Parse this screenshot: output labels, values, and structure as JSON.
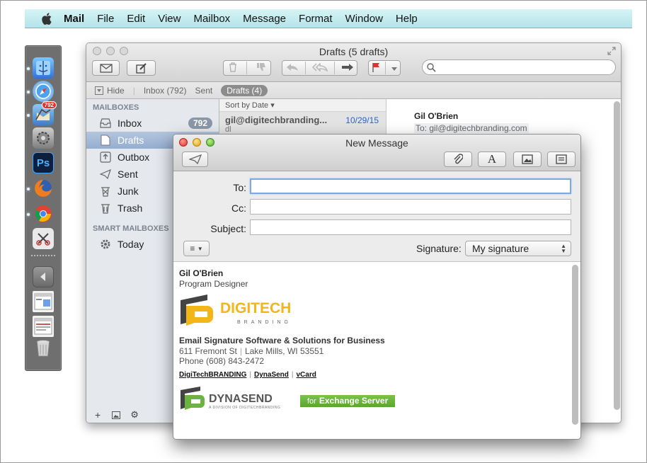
{
  "menubar": {
    "app": "Mail",
    "items": [
      "File",
      "Edit",
      "View",
      "Mailbox",
      "Message",
      "Format",
      "Window",
      "Help"
    ]
  },
  "dock": {
    "items": [
      {
        "icon": "finder-icon"
      },
      {
        "icon": "safari-icon"
      },
      {
        "icon": "mail-icon",
        "badge": "792"
      },
      {
        "icon": "system-preferences-icon"
      },
      {
        "icon": "photoshop-icon",
        "text": "Ps"
      },
      {
        "icon": "firefox-icon"
      },
      {
        "icon": "chrome-icon"
      },
      {
        "icon": "snipping-tool-icon"
      },
      {
        "icon": "back-arrow-icon"
      },
      {
        "icon": "window-thumbnail-icon"
      },
      {
        "icon": "window-thumbnail-icon"
      },
      {
        "icon": "trash-icon"
      }
    ]
  },
  "mail": {
    "title": "Drafts (5 drafts)",
    "favorites": {
      "hide": "Hide",
      "inbox": "Inbox (792)",
      "sent": "Sent",
      "drafts": "Drafts (4)"
    },
    "sidebar": {
      "mailboxes_header": "MAILBOXES",
      "smart_header": "SMART MAILBOXES",
      "items": [
        {
          "label": "Inbox",
          "count": "792"
        },
        {
          "label": "Drafts"
        },
        {
          "label": "Outbox"
        },
        {
          "label": "Sent"
        },
        {
          "label": "Junk"
        },
        {
          "label": "Trash"
        }
      ],
      "smart_items": [
        {
          "label": "Today"
        }
      ],
      "bottom": {
        "add": "+",
        "gear": "⚙"
      }
    },
    "list": {
      "sort": "Sort by Date",
      "message": {
        "from": "gil@digitechbranding...",
        "date": "10/29/15",
        "preview": "dl"
      }
    },
    "viewer": {
      "name": "Gil O'Brien",
      "to_label": "To:",
      "to": "gil@digitechbranding.com"
    }
  },
  "compose": {
    "title": "New Message",
    "fields": {
      "to_label": "To:",
      "cc_label": "Cc:",
      "subject_label": "Subject:",
      "to_value": "",
      "cc_value": "",
      "subject_value": ""
    },
    "signature_label": "Signature:",
    "signature_value": "My signature",
    "format_button": "≡",
    "body": {
      "name": "Gil O'Brien",
      "role": "Program Designer",
      "logo_main": "DIGITECH",
      "logo_sub": "BRANDING",
      "company": "Email Signature Software & Solutions for Business",
      "address_street": "611 Fremont St",
      "address_city": "Lake Mills, WI 53551",
      "phone": "Phone (608) 843-2472",
      "links": [
        "DigiTechBRANDING",
        "DynaSend",
        "vCard"
      ],
      "dyna_main": "DYNASEND",
      "dyna_sub": "A DIVISION OF DIGITECHBRANDING",
      "exchange_pre": "for",
      "exchange_main": "Exchange Server"
    }
  },
  "colors": {
    "menubar": "#c4ecef",
    "accent_green": "#6cb33f",
    "accent_yellow": "#f2b619",
    "selection": "#9cb3d4",
    "date_blue": "#2a62c9"
  }
}
